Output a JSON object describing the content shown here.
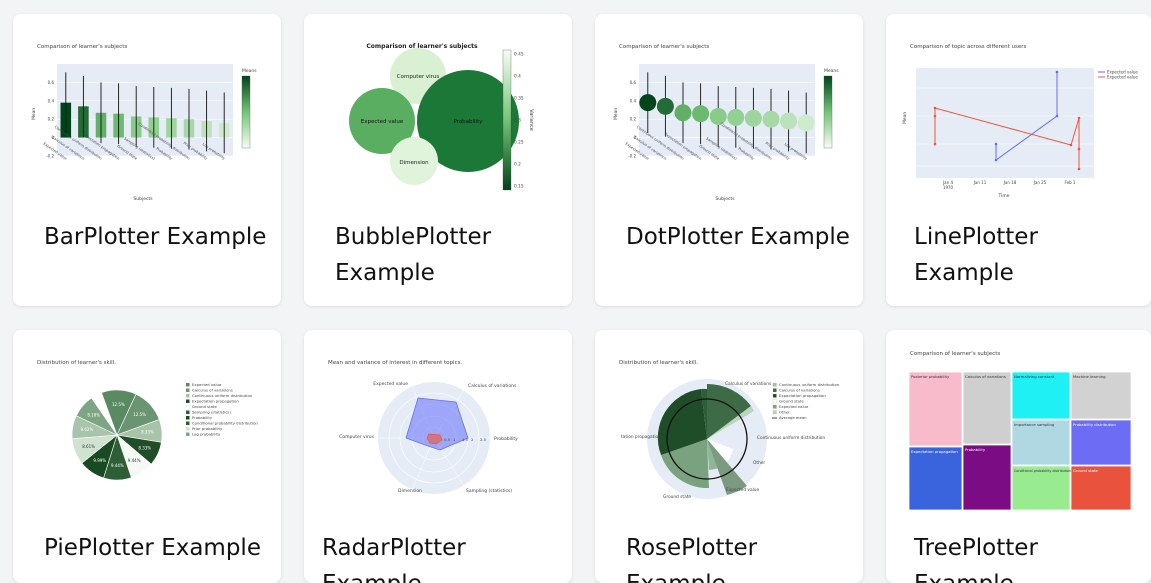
{
  "cards": [
    {
      "title": "BarPlotter Example",
      "chart_data": {
        "type": "bar",
        "title": "Comparison of learner's subjects",
        "xlabel": "Subjects",
        "ylabel": "Mean",
        "colorbar_title": "Means",
        "categories": [
          "Expected value",
          "Calculus of variations",
          "Continuous uniform distribution",
          "Expectation propagation",
          "Ground state",
          "Sampling (statistics)",
          "Probability",
          "Conditional probability distribution",
          "Prior probability",
          "Log probability"
        ],
        "values": [
          0.38,
          0.34,
          0.27,
          0.26,
          0.23,
          0.22,
          0.21,
          0.2,
          0.18,
          0.16
        ],
        "ylim": [
          -0.2,
          0.8
        ]
      }
    },
    {
      "title": "BubblePlotter Example",
      "chart_data": {
        "type": "scatter",
        "title": "Comparison of learner's subjects",
        "colorbar_title": "Variance",
        "colorbar_ticks": [
          "0.45",
          "0.4",
          "0.35",
          "0.3",
          "0.25",
          "0.2",
          "0.15"
        ],
        "bubbles": [
          {
            "label": "Computer virus",
            "size": 0.6,
            "value": 0.38
          },
          {
            "label": "Expected value",
            "size": 0.9,
            "value": 0.25
          },
          {
            "label": "Probability",
            "size": 1.4,
            "value": 0.16
          },
          {
            "label": "Dimension",
            "size": 0.6,
            "value": 0.4
          }
        ]
      }
    },
    {
      "title": "DotPlotter Example",
      "chart_data": {
        "type": "scatter",
        "title": "Comparison of learner's subjects",
        "xlabel": "Subjects",
        "ylabel": "Mean",
        "colorbar_title": "Means",
        "categories": [
          "Expected value",
          "Calculus of variations",
          "Continuous uniform distribution",
          "Expectation propagation",
          "Ground state",
          "Sampling (statistics)",
          "Probability",
          "Conditional probability distribution",
          "Prior probability",
          "Log probability"
        ],
        "values": [
          0.38,
          0.34,
          0.27,
          0.26,
          0.23,
          0.22,
          0.21,
          0.2,
          0.18,
          0.16
        ],
        "ylim": [
          -0.2,
          0.8
        ]
      }
    },
    {
      "title": "LinePlotter Example",
      "chart_data": {
        "type": "line",
        "title": "Comparison of topic across different users",
        "xlabel": "Time",
        "ylabel": "Mean",
        "x_ticks": [
          "Jan 4\n1970",
          "Jan 11",
          "Jan 18",
          "Jan 25",
          "Feb 1"
        ],
        "series": [
          {
            "name": "Expected value",
            "color": "#636efa"
          },
          {
            "name": "Expected value",
            "color": "#ef553b"
          }
        ]
      }
    },
    {
      "title": "PiePlotter Example",
      "chart_data": {
        "type": "pie",
        "title": "Distribution of learner's skill.",
        "slice_labels": [
          "12.5%",
          "12.5%",
          "8.33%",
          "8.33%",
          "9.44%",
          "9.44%",
          "9.99%",
          "8.61%",
          "8.62%",
          "8.18%"
        ],
        "legend": [
          "Expected value",
          "Calculus of variations",
          "Continuous uniform distribution",
          "Expectation propagation",
          "Ground state",
          "Sampling (statistics)",
          "Probability",
          "Conditional probability distribution",
          "Prior probability",
          "Log probability"
        ]
      }
    },
    {
      "title": "RadarPlotter Example",
      "chart_data": {
        "type": "radar",
        "title": "Mean and variance of interest in different topics.",
        "axes": [
          "Expected value",
          "Calculus of variations",
          "Probability",
          "Sampling (statistics)",
          "Dimension",
          "Computer virus"
        ],
        "radial_ticks": [
          "0.5",
          "1",
          "1.5",
          "2",
          "2.5"
        ]
      }
    },
    {
      "title": "RosePlotter Example",
      "chart_data": {
        "type": "rose",
        "title": "Distribution of learner's skill.",
        "labels": [
          "Calculus of variations",
          "Continuous uniform distribution",
          "Other",
          "Expected value",
          "Ground state",
          "tation propagation"
        ],
        "legend": [
          "Continuous uniform distribution",
          "Calculus of variations",
          "Expectation propagation",
          "Ground state",
          "Expected value",
          "Other",
          "Average mean"
        ]
      }
    },
    {
      "title": "TreePlotter Example",
      "chart_data": {
        "type": "treemap",
        "title": "Comparison of learner's subjects",
        "tiles": [
          "Posterior probability",
          "Calculus of variations",
          "Normalizing constant",
          "Machine learning",
          "Importance sampling",
          "Probability distribution",
          "Expectation propagation",
          "Probability",
          "Conditional probability distribution",
          "Ground state"
        ]
      }
    }
  ]
}
